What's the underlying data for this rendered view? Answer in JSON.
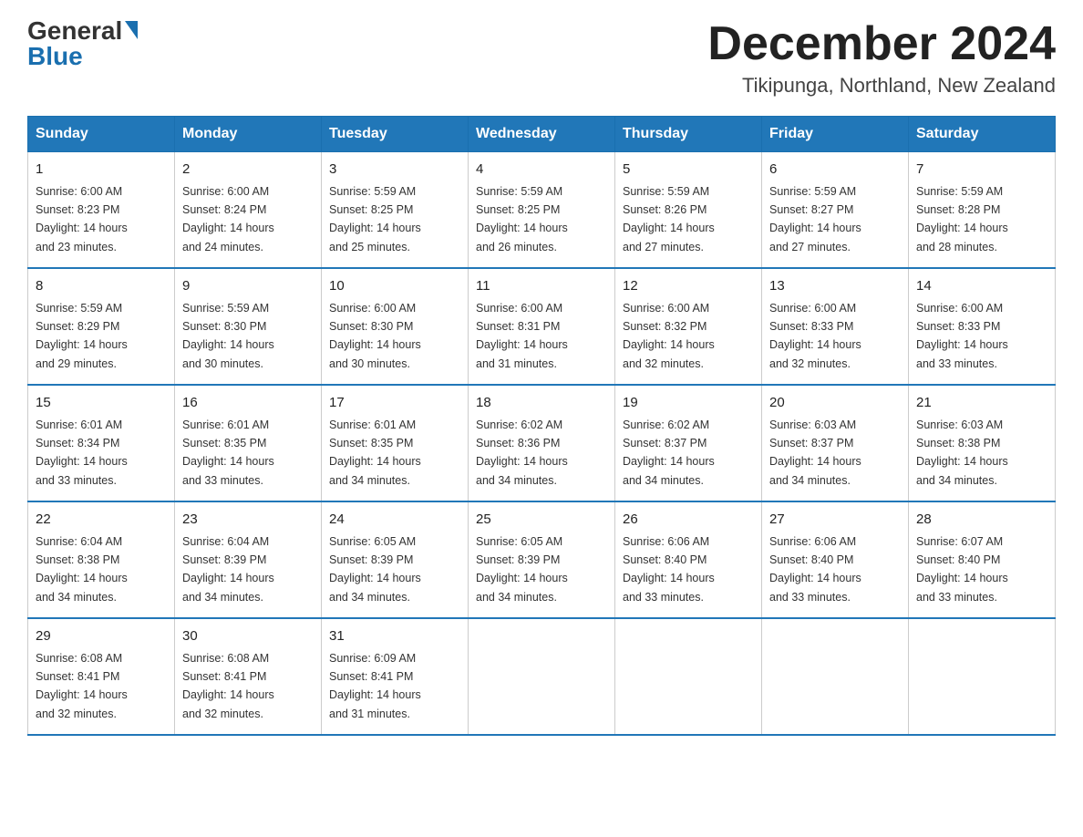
{
  "logo": {
    "general": "General",
    "blue": "Blue"
  },
  "title": "December 2024",
  "subtitle": "Tikipunga, Northland, New Zealand",
  "days": [
    "Sunday",
    "Monday",
    "Tuesday",
    "Wednesday",
    "Thursday",
    "Friday",
    "Saturday"
  ],
  "weeks": [
    [
      {
        "day": "1",
        "sunrise": "6:00 AM",
        "sunset": "8:23 PM",
        "daylight": "14 hours and 23 minutes."
      },
      {
        "day": "2",
        "sunrise": "6:00 AM",
        "sunset": "8:24 PM",
        "daylight": "14 hours and 24 minutes."
      },
      {
        "day": "3",
        "sunrise": "5:59 AM",
        "sunset": "8:25 PM",
        "daylight": "14 hours and 25 minutes."
      },
      {
        "day": "4",
        "sunrise": "5:59 AM",
        "sunset": "8:25 PM",
        "daylight": "14 hours and 26 minutes."
      },
      {
        "day": "5",
        "sunrise": "5:59 AM",
        "sunset": "8:26 PM",
        "daylight": "14 hours and 27 minutes."
      },
      {
        "day": "6",
        "sunrise": "5:59 AM",
        "sunset": "8:27 PM",
        "daylight": "14 hours and 27 minutes."
      },
      {
        "day": "7",
        "sunrise": "5:59 AM",
        "sunset": "8:28 PM",
        "daylight": "14 hours and 28 minutes."
      }
    ],
    [
      {
        "day": "8",
        "sunrise": "5:59 AM",
        "sunset": "8:29 PM",
        "daylight": "14 hours and 29 minutes."
      },
      {
        "day": "9",
        "sunrise": "5:59 AM",
        "sunset": "8:30 PM",
        "daylight": "14 hours and 30 minutes."
      },
      {
        "day": "10",
        "sunrise": "6:00 AM",
        "sunset": "8:30 PM",
        "daylight": "14 hours and 30 minutes."
      },
      {
        "day": "11",
        "sunrise": "6:00 AM",
        "sunset": "8:31 PM",
        "daylight": "14 hours and 31 minutes."
      },
      {
        "day": "12",
        "sunrise": "6:00 AM",
        "sunset": "8:32 PM",
        "daylight": "14 hours and 32 minutes."
      },
      {
        "day": "13",
        "sunrise": "6:00 AM",
        "sunset": "8:33 PM",
        "daylight": "14 hours and 32 minutes."
      },
      {
        "day": "14",
        "sunrise": "6:00 AM",
        "sunset": "8:33 PM",
        "daylight": "14 hours and 33 minutes."
      }
    ],
    [
      {
        "day": "15",
        "sunrise": "6:01 AM",
        "sunset": "8:34 PM",
        "daylight": "14 hours and 33 minutes."
      },
      {
        "day": "16",
        "sunrise": "6:01 AM",
        "sunset": "8:35 PM",
        "daylight": "14 hours and 33 minutes."
      },
      {
        "day": "17",
        "sunrise": "6:01 AM",
        "sunset": "8:35 PM",
        "daylight": "14 hours and 34 minutes."
      },
      {
        "day": "18",
        "sunrise": "6:02 AM",
        "sunset": "8:36 PM",
        "daylight": "14 hours and 34 minutes."
      },
      {
        "day": "19",
        "sunrise": "6:02 AM",
        "sunset": "8:37 PM",
        "daylight": "14 hours and 34 minutes."
      },
      {
        "day": "20",
        "sunrise": "6:03 AM",
        "sunset": "8:37 PM",
        "daylight": "14 hours and 34 minutes."
      },
      {
        "day": "21",
        "sunrise": "6:03 AM",
        "sunset": "8:38 PM",
        "daylight": "14 hours and 34 minutes."
      }
    ],
    [
      {
        "day": "22",
        "sunrise": "6:04 AM",
        "sunset": "8:38 PM",
        "daylight": "14 hours and 34 minutes."
      },
      {
        "day": "23",
        "sunrise": "6:04 AM",
        "sunset": "8:39 PM",
        "daylight": "14 hours and 34 minutes."
      },
      {
        "day": "24",
        "sunrise": "6:05 AM",
        "sunset": "8:39 PM",
        "daylight": "14 hours and 34 minutes."
      },
      {
        "day": "25",
        "sunrise": "6:05 AM",
        "sunset": "8:39 PM",
        "daylight": "14 hours and 34 minutes."
      },
      {
        "day": "26",
        "sunrise": "6:06 AM",
        "sunset": "8:40 PM",
        "daylight": "14 hours and 33 minutes."
      },
      {
        "day": "27",
        "sunrise": "6:06 AM",
        "sunset": "8:40 PM",
        "daylight": "14 hours and 33 minutes."
      },
      {
        "day": "28",
        "sunrise": "6:07 AM",
        "sunset": "8:40 PM",
        "daylight": "14 hours and 33 minutes."
      }
    ],
    [
      {
        "day": "29",
        "sunrise": "6:08 AM",
        "sunset": "8:41 PM",
        "daylight": "14 hours and 32 minutes."
      },
      {
        "day": "30",
        "sunrise": "6:08 AM",
        "sunset": "8:41 PM",
        "daylight": "14 hours and 32 minutes."
      },
      {
        "day": "31",
        "sunrise": "6:09 AM",
        "sunset": "8:41 PM",
        "daylight": "14 hours and 31 minutes."
      },
      null,
      null,
      null,
      null
    ]
  ]
}
